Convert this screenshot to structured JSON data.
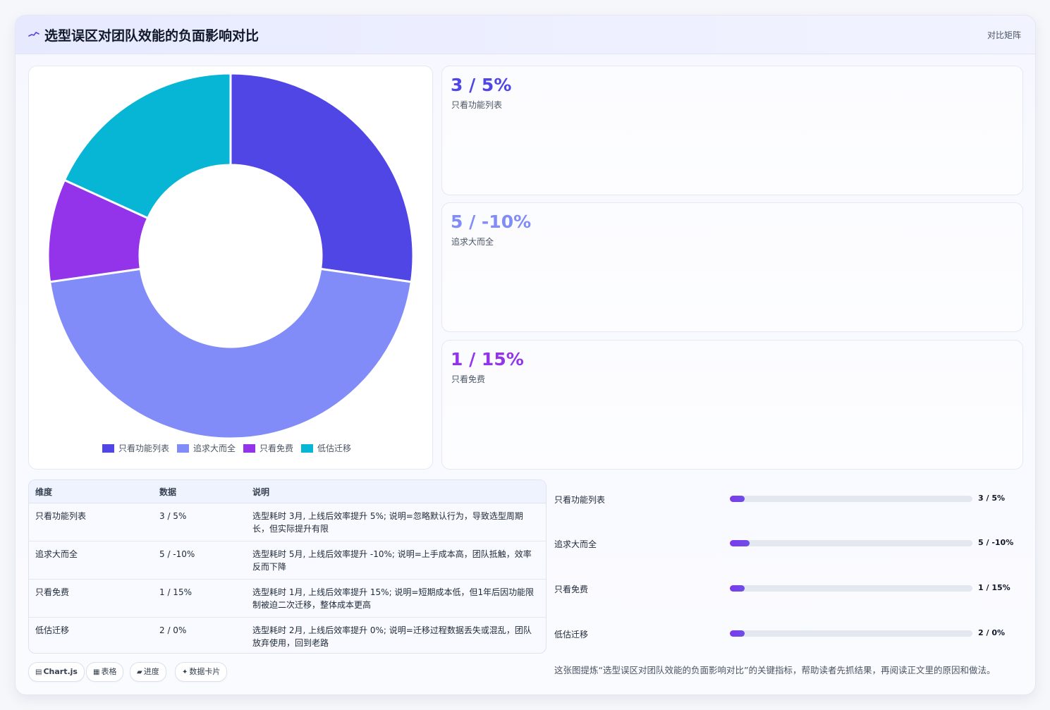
{
  "header": {
    "title": "选型误区对团队效能的负面影响对比",
    "tag": "对比矩阵"
  },
  "colors": {
    "s1": "#4f46e5",
    "s2": "#818cf8",
    "s3": "#9333ea",
    "s4": "#06b6d4"
  },
  "chart_data": {
    "type": "pie",
    "categories": [
      "只看功能列表",
      "追求大而全",
      "只看免费",
      "低估迁移"
    ],
    "values": [
      3,
      5,
      1,
      2
    ],
    "legend": "bottom",
    "variant": "doughnut"
  },
  "metrics": [
    {
      "value": "3 / 5%",
      "label": "只看功能列表",
      "color": "#4f46e5"
    },
    {
      "value": "5 / -10%",
      "label": "追求大而全",
      "color": "#818cf8"
    },
    {
      "value": "1 / 15%",
      "label": "只看免费",
      "color": "#9333ea"
    }
  ],
  "table": {
    "headers": [
      "维度",
      "数据",
      "说明"
    ],
    "rows": [
      [
        "只看功能列表",
        "3 / 5%",
        "选型耗时 3月, 上线后效率提升 5%; 说明=忽略默认行为，导致选型周期长，但实际提升有限"
      ],
      [
        "追求大而全",
        "5 / -10%",
        "选型耗时 5月, 上线后效率提升 -10%; 说明=上手成本高，团队抵触，效率反而下降"
      ],
      [
        "只看免费",
        "1 / 15%",
        "选型耗时 1月, 上线后效率提升 15%; 说明=短期成本低，但1年后因功能限制被迫二次迁移，整体成本更高"
      ],
      [
        "低估迁移",
        "2 / 0%",
        "选型耗时 2月, 上线后效率提升 0%; 说明=迁移过程数据丢失或混乱，团队放弃使用，回到老路"
      ]
    ]
  },
  "progress": [
    {
      "label": "只看功能列表",
      "value": "3 / 5%",
      "fraction": 0.06
    },
    {
      "label": "追求大而全",
      "value": "5 / -10%",
      "fraction": 0.08
    },
    {
      "label": "只看免费",
      "value": "1 / 15%",
      "fraction": 0.06
    },
    {
      "label": "低估迁移",
      "value": "2 / 0%",
      "fraction": 0.06
    }
  ],
  "chips": [
    {
      "icon": "▤",
      "label": "Chart.js"
    },
    {
      "icon": "▦",
      "label": "表格"
    },
    {
      "icon": "▰",
      "label": "进度"
    },
    {
      "icon": "✦",
      "label": "数据卡片"
    }
  ],
  "note": "这张图提炼“选型误区对团队效能的负面影响对比”的关键指标，帮助读者先抓结果，再阅读正文里的原因和做法。"
}
